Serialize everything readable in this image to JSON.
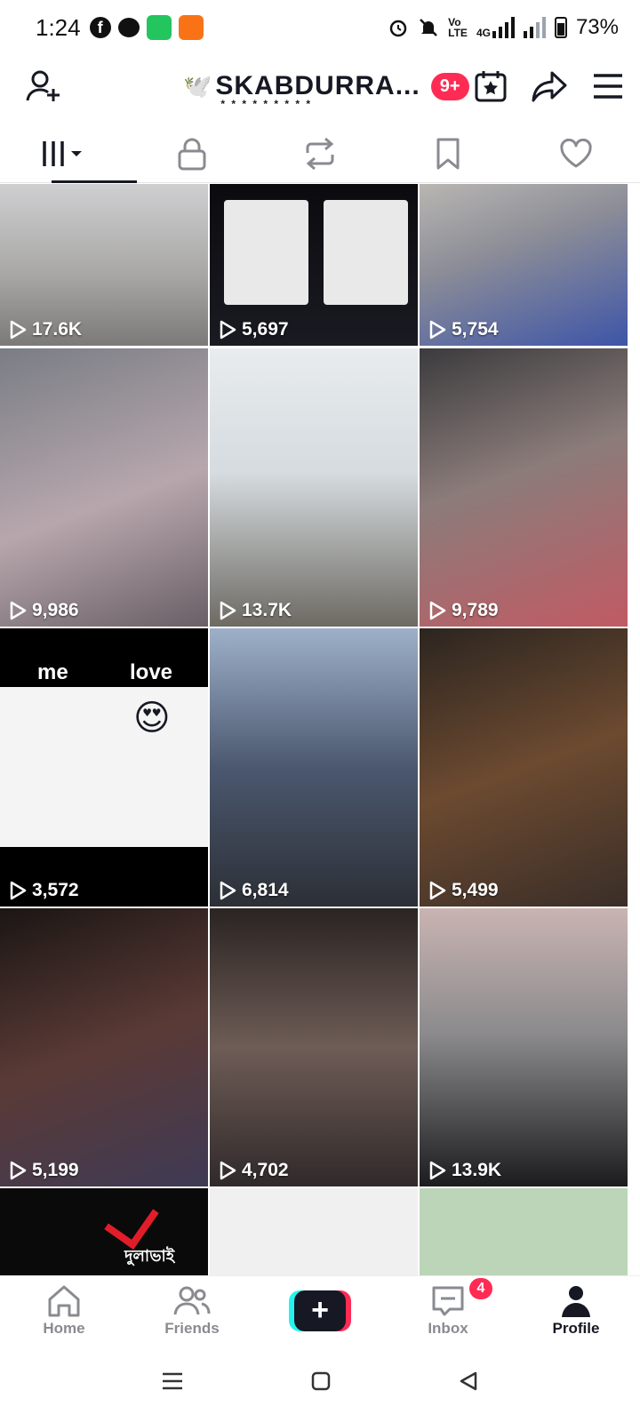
{
  "status_bar": {
    "time": "1:24",
    "network_label_top": "Vo",
    "network_label_bottom": "LTE",
    "network_gen": "4G",
    "battery": "73%"
  },
  "header": {
    "username": "SKABDURRA...",
    "notif_badge": "9+"
  },
  "tabs": [
    {
      "name": "videos",
      "icon": "grid-icon"
    },
    {
      "name": "private",
      "icon": "lock-icon"
    },
    {
      "name": "reposts",
      "icon": "repost-icon"
    },
    {
      "name": "favorites",
      "icon": "bookmark-icon"
    },
    {
      "name": "liked",
      "icon": "heart-icon"
    }
  ],
  "videos": [
    {
      "views": "17.6K",
      "bg": "linear-gradient(180deg,#cfcfd1 0%,#a9a8a6 55%,#7c7a78 100%)"
    },
    {
      "views": "5,697",
      "bg": "linear-gradient(180deg,#0b0b0f 0%,#1a1a22 100%)"
    },
    {
      "views": "5,754",
      "bg": "linear-gradient(160deg,#b9b6b2 0%,#8c8d97 40%,#3e55a8 100%)"
    },
    {
      "views": "9,986",
      "bg": "linear-gradient(160deg,#7a7d85 0%,#b7a7ad 55%,#6a5f66 100%)"
    },
    {
      "views": "13.7K",
      "bg": "linear-gradient(180deg,#e8ecef 0%,#d5dbdf 45%,#6d6a63 100%)"
    },
    {
      "views": "9,789",
      "bg": "linear-gradient(160deg,#3b3b3d 0%,#8b7c7a 45%,#c15a63 100%)"
    },
    {
      "views": "3,572",
      "bg": "#000000"
    },
    {
      "views": "6,814",
      "bg": "linear-gradient(180deg,#9eb0c9 0%,#4b586f 50%,#2c2f36 100%)"
    },
    {
      "views": "5,499",
      "bg": "linear-gradient(160deg,#2c2520 0%,#6c4a30 50%,#3a2e28 100%)"
    },
    {
      "views": "5,199",
      "bg": "linear-gradient(160deg,#1b1614 0%,#5a3a36 50%,#3f3a55 100%)"
    },
    {
      "views": "4,702",
      "bg": "linear-gradient(180deg,#2a2422 0%,#6e5c56 50%,#302a2a 100%)"
    },
    {
      "views": "13.9K",
      "bg": "linear-gradient(180deg,#c9b4b2 0%,#8b8a8c 45%,#1c1c1e 100%)"
    }
  ],
  "partial_tiles": [
    {
      "bg": "#0a0a0a",
      "text": "দুলাভাই"
    },
    {
      "bg": "#f1f0f1",
      "text": ""
    },
    {
      "bg": "#bcd4b8",
      "text": ""
    }
  ],
  "overlay_texts": {
    "me": "me",
    "love": "love"
  },
  "bottom_nav": [
    {
      "label": "Home",
      "icon": "home-icon"
    },
    {
      "label": "Friends",
      "icon": "friends-icon"
    },
    {
      "label": "",
      "icon": "create-icon"
    },
    {
      "label": "Inbox",
      "icon": "inbox-icon",
      "badge": "4"
    },
    {
      "label": "Profile",
      "icon": "profile-icon"
    }
  ],
  "colors": {
    "accent": "#fe2c55",
    "accent2": "#25f4ee",
    "text": "#161823",
    "muted": "#8a8b91"
  }
}
